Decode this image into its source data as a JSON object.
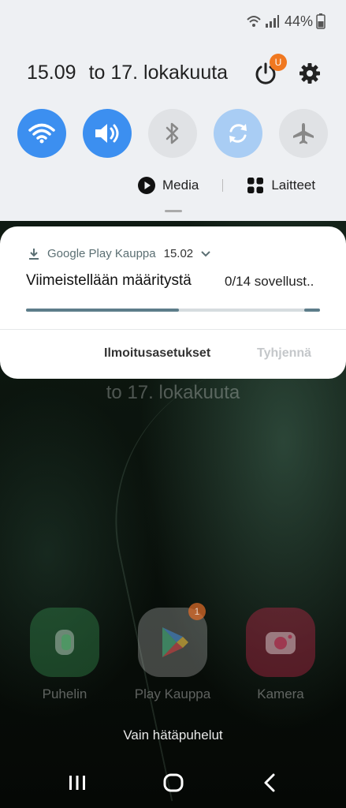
{
  "status_bar": {
    "battery_percent": "44%",
    "icons": [
      "wifi-icon",
      "signal-icon",
      "battery-icon"
    ]
  },
  "quick_panel": {
    "time": "15.09",
    "date": "to 17. lokakuuta",
    "power_badge": "U",
    "tiles": [
      {
        "name": "wifi",
        "state": "on"
      },
      {
        "name": "sound",
        "state": "on"
      },
      {
        "name": "bluetooth",
        "state": "off"
      },
      {
        "name": "auto-rotate",
        "state": "on"
      },
      {
        "name": "airplane-mode",
        "state": "off"
      }
    ],
    "media_label": "Media",
    "devices_label": "Laitteet"
  },
  "notification": {
    "app_name": "Google Play Kauppa",
    "time": "15.02",
    "title": "Viimeistellään määritystä",
    "count": "0/14 sovellust..",
    "progress_fraction": 0.52,
    "action_settings": "Ilmoitusasetukset",
    "action_clear": "Tyhjennä"
  },
  "lockscreen": {
    "date": "to 17. lokakuuta",
    "apps": [
      {
        "label": "Puhelin"
      },
      {
        "label": "Play Kauppa",
        "badge": "1"
      },
      {
        "label": "Kamera"
      }
    ],
    "emergency_text": "Vain hätäpuhelut"
  },
  "colors": {
    "accent": "#3c8ff0",
    "panel_bg": "#eef0f3",
    "badge": "#f07820"
  }
}
